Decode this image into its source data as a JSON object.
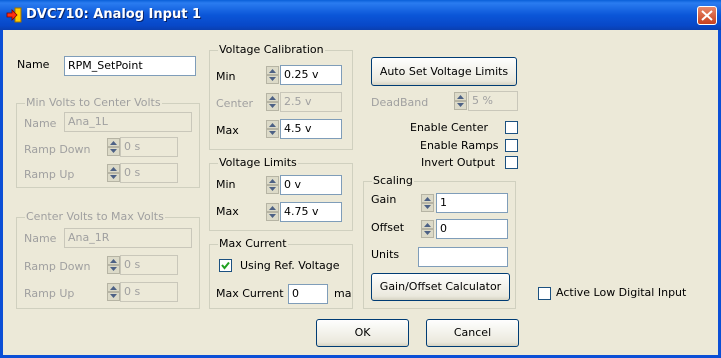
{
  "window": {
    "title": "DVC710: Analog Input 1"
  },
  "name": {
    "label": "Name",
    "value": "RPM_SetPoint"
  },
  "min_to_center": {
    "caption": "Min Volts to Center Volts",
    "name_label": "Name",
    "name_value": "Ana_1L",
    "ramp_down_label": "Ramp Down",
    "ramp_down_value": "0 s",
    "ramp_up_label": "Ramp Up",
    "ramp_up_value": "0 s"
  },
  "center_to_max": {
    "caption": "Center Volts to Max Volts",
    "name_label": "Name",
    "name_value": "Ana_1R",
    "ramp_down_label": "Ramp Down",
    "ramp_down_value": "0 s",
    "ramp_up_label": "Ramp Up",
    "ramp_up_value": "0 s"
  },
  "voltage_calibration": {
    "caption": "Voltage Calibration",
    "min_label": "Min",
    "min_value": "0.25 v",
    "center_label": "Center",
    "center_value": "2.5 v",
    "max_label": "Max",
    "max_value": "4.5 v"
  },
  "voltage_limits": {
    "caption": "Voltage Limits",
    "min_label": "Min",
    "min_value": "0 v",
    "max_label": "Max",
    "max_value": "4.75 v"
  },
  "max_current": {
    "caption": "Max Current",
    "using_ref_label": "Using Ref. Voltage",
    "using_ref_checked": true,
    "max_current_label": "Max Current",
    "max_current_value": "0",
    "unit": "ma"
  },
  "auto_set_button": "Auto Set Voltage Limits",
  "deadband": {
    "label": "DeadBand",
    "value": "5 %"
  },
  "options": {
    "enable_center": "Enable Center",
    "enable_ramps": "Enable Ramps",
    "invert_output": "Invert Output"
  },
  "scaling": {
    "caption": "Scaling",
    "gain_label": "Gain",
    "gain_value": "1",
    "offset_label": "Offset",
    "offset_value": "0",
    "units_label": "Units",
    "units_value": ""
  },
  "gain_offset_button": "Gain/Offset Calculator",
  "active_low_label": "Active Low Digital Input",
  "ok_button": "OK",
  "cancel_button": "Cancel",
  "colors": {
    "title_bar": "#0b56d8",
    "face": "#ece9d8",
    "close": "#c8401e"
  }
}
